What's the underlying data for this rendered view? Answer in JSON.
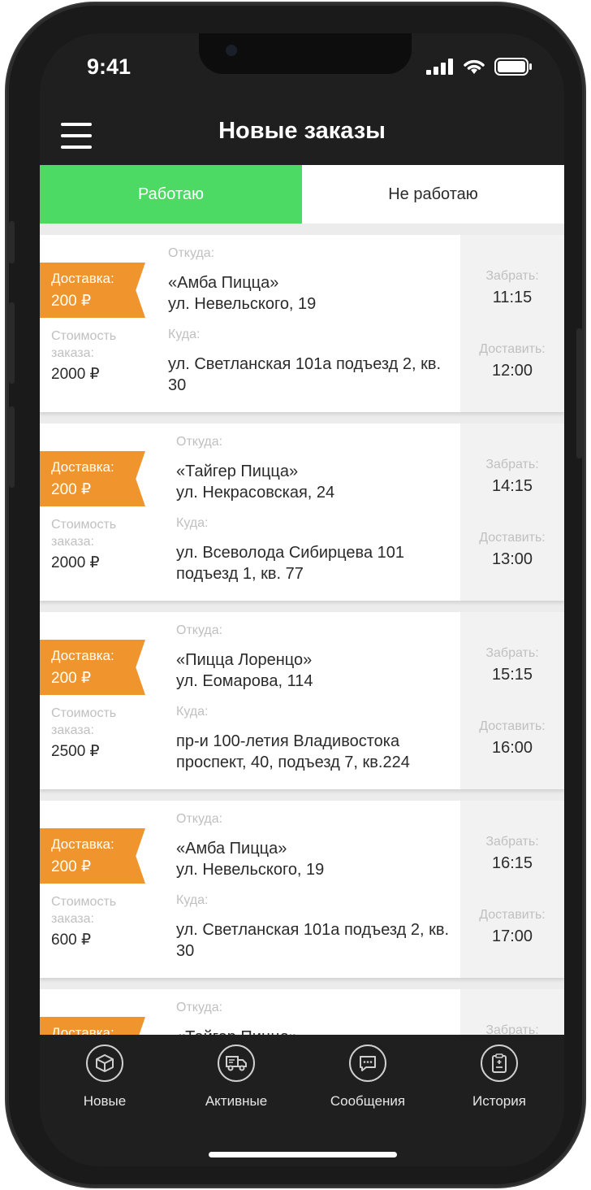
{
  "status_bar": {
    "time": "9:41"
  },
  "header": {
    "title": "Новые заказы"
  },
  "tabs": [
    {
      "label": "Работаю",
      "active": true
    },
    {
      "label": "Не работаю",
      "active": false
    }
  ],
  "orders": [
    {
      "delivery_label": "Доставка:",
      "delivery_price": "200 ₽",
      "cost_label": "Стоимость заказа:",
      "cost_value": "2000 ₽",
      "from_label": "Откуда:",
      "from_name": "«Амба Пицца»",
      "from_address": "ул. Невельского, 19",
      "to_label": "Куда:",
      "to_address": "ул. Светланская 101а подъезд 2, кв. 30",
      "pickup_label": "Забрать:",
      "pickup_time": "11:15",
      "deliver_label": "Доставить:",
      "deliver_time": "12:00"
    },
    {
      "delivery_label": "Доставка:",
      "delivery_price": "200 ₽",
      "cost_label": "Стоимость заказа:",
      "cost_value": "2000 ₽",
      "from_label": "Откуда:",
      "from_name": "«Тайгер Пицца»",
      "from_address": "ул. Некрасовская, 24",
      "to_label": "Куда:",
      "to_address": "ул. Всеволода Сибирцева 101 подъезд 1, кв. 77",
      "pickup_label": "Забрать:",
      "pickup_time": "14:15",
      "deliver_label": "Доставить:",
      "deliver_time": "13:00"
    },
    {
      "delivery_label": "Доставка:",
      "delivery_price": "200 ₽",
      "cost_label": "Стоимость заказа:",
      "cost_value": "2500 ₽",
      "from_label": "Откуда:",
      "from_name": "«Пицца Лоренцо»",
      "from_address": "ул. Еомарова, 114",
      "to_label": "Куда:",
      "to_address": "пр-и 100-летия Владивостока проспект, 40, подъезд 7, кв.224",
      "pickup_label": "Забрать:",
      "pickup_time": "15:15",
      "deliver_label": "Доставить:",
      "deliver_time": "16:00"
    },
    {
      "delivery_label": "Доставка:",
      "delivery_price": "200 ₽",
      "cost_label": "Стоимость заказа:",
      "cost_value": "600 ₽",
      "from_label": "Откуда:",
      "from_name": "«Амба Пицца»",
      "from_address": "ул. Невельского, 19",
      "to_label": "Куда:",
      "to_address": "ул. Светланская 101а подъезд 2, кв. 30",
      "pickup_label": "Забрать:",
      "pickup_time": "16:15",
      "deliver_label": "Доставить:",
      "deliver_time": "17:00"
    },
    {
      "delivery_label": "Доставка:",
      "delivery_price": "",
      "cost_label": "",
      "cost_value": "",
      "from_label": "Откуда:",
      "from_name": "«Тайгер Пицца»",
      "from_address": "",
      "to_label": "",
      "to_address": "",
      "pickup_label": "Забрать:",
      "pickup_time": "",
      "deliver_label": "",
      "deliver_time": ""
    }
  ],
  "bottom_nav": [
    {
      "label": "Новые",
      "icon": "box-icon"
    },
    {
      "label": "Активные",
      "icon": "truck-icon"
    },
    {
      "label": "Сообщения",
      "icon": "chat-icon"
    },
    {
      "label": "История",
      "icon": "clipboard-icon"
    }
  ],
  "colors": {
    "accent_green": "#4cd964",
    "ribbon_orange": "#f0952e",
    "dark_bg": "#1f1f1f"
  }
}
